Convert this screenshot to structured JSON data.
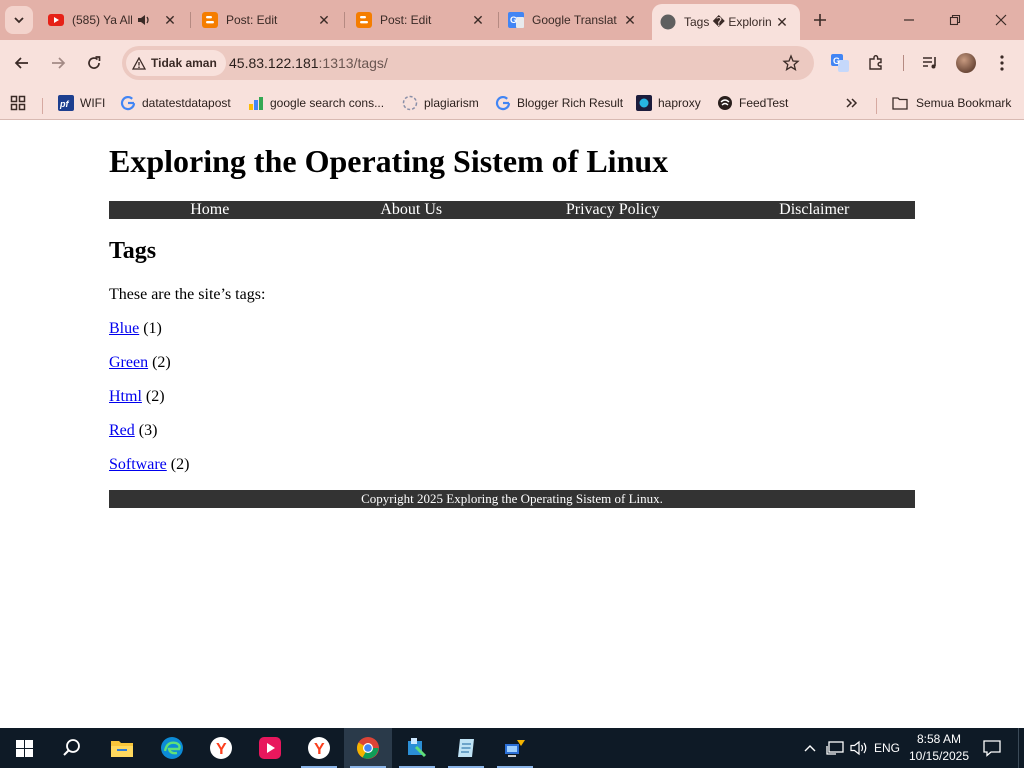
{
  "browser": {
    "tabs": [
      {
        "title": "(585) Ya All",
        "favicon": "youtube-icon",
        "audio": true
      },
      {
        "title": "Post: Edit",
        "favicon": "blogger-icon"
      },
      {
        "title": "Post: Edit",
        "favicon": "blogger-icon"
      },
      {
        "title": "Google Translat",
        "favicon": "google-translate-icon"
      },
      {
        "title": "Tags � Explorin",
        "favicon": "globe-icon",
        "active": true
      }
    ],
    "address": {
      "security_label": "Tidak aman",
      "url_host": "45.83.122.181",
      "url_rest": ":1313/tags/"
    },
    "bookmarks": [
      {
        "label": "WIFI",
        "icon": "pf-icon"
      },
      {
        "label": "datatestdatapost",
        "icon": "google-icon"
      },
      {
        "label": "google search cons...",
        "icon": "search-console-icon"
      },
      {
        "label": "plagiarism",
        "icon": "plagiarism-icon"
      },
      {
        "label": "Blogger Rich Result",
        "icon": "google-icon"
      },
      {
        "label": "haproxy",
        "icon": "haproxy-icon"
      },
      {
        "label": "FeedTest",
        "icon": "feed-icon"
      }
    ],
    "bookmarks_folder": "Semua Bookmark",
    "colors": {
      "frame": "#e3b1a8",
      "toolbar": "#f8e1dc"
    }
  },
  "page": {
    "site_title": "Exploring the Operating Sistem of Linux",
    "nav": [
      "Home",
      "About Us",
      "Privacy Policy",
      "Disclaimer"
    ],
    "heading": "Tags",
    "intro": "These are the site’s tags:",
    "tags": [
      {
        "name": "Blue",
        "count": "(1)"
      },
      {
        "name": "Green",
        "count": "(2)"
      },
      {
        "name": "Html",
        "count": "(2)"
      },
      {
        "name": "Red",
        "count": "(3)"
      },
      {
        "name": "Software",
        "count": "(2)"
      }
    ],
    "footer": "Copyright 2025 Exploring the Operating Sistem of Linux.",
    "colors": {
      "nav_bg": "#333333",
      "link": "#0000ee"
    }
  },
  "taskbar": {
    "apps": [
      "start-icon",
      "search-icon",
      "file-explorer-icon",
      "edge-icon",
      "yandex-icon",
      "media-player-icon",
      "yandex-icon",
      "chrome-icon",
      "security-icon",
      "notepad-icon",
      "network-tool-icon"
    ],
    "language": "ENG",
    "time": "8:58 AM",
    "date": "10/15/2025"
  }
}
